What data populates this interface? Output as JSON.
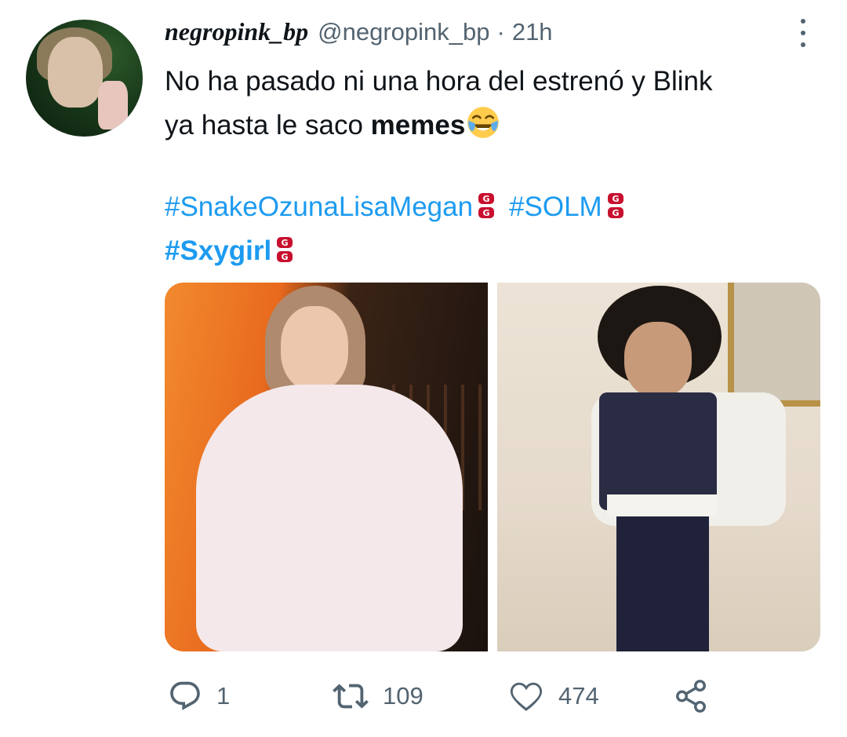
{
  "tweet": {
    "display_name": "negropink_bp",
    "handle": "@negropink_bp",
    "separator": "·",
    "time": "21h",
    "text_line1": "No ha pasado ni una hora del estrenó y Blink",
    "text_line2_prefix": "ya hasta le saco ",
    "text_bold": "memes",
    "emoji_icon": "face-with-tears-of-joy-icon",
    "hashtags": [
      {
        "label": "#SnakeOzunaLisaMegan"
      },
      {
        "label": "#SOLM"
      },
      {
        "label": "#Sxygirl"
      }
    ]
  },
  "actions": {
    "replies": "1",
    "retweets": "109",
    "likes": "474"
  },
  "colors": {
    "link": "#1d9bf0",
    "muted": "#536471",
    "text": "#0f1419"
  }
}
